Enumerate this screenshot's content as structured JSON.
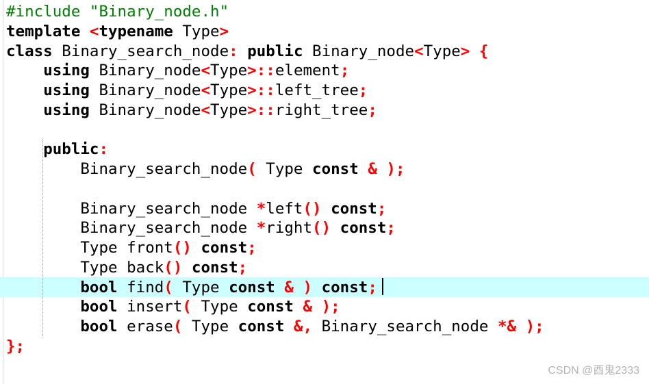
{
  "code_lines": [
    [
      {
        "cls": "pp",
        "text": "#include"
      },
      {
        "cls": "id",
        "text": " "
      },
      {
        "cls": "str",
        "text": "\"Binary_node.h\""
      }
    ],
    [
      {
        "cls": "kw",
        "text": "template"
      },
      {
        "cls": "id",
        "text": " "
      },
      {
        "cls": "op",
        "text": "<"
      },
      {
        "cls": "kw",
        "text": "typename"
      },
      {
        "cls": "id",
        "text": " Type"
      },
      {
        "cls": "op",
        "text": ">"
      }
    ],
    [
      {
        "cls": "kw",
        "text": "class"
      },
      {
        "cls": "id",
        "text": " Binary_search_node"
      },
      {
        "cls": "op",
        "text": ":"
      },
      {
        "cls": "id",
        "text": " "
      },
      {
        "cls": "kw",
        "text": "public"
      },
      {
        "cls": "id",
        "text": " Binary_node"
      },
      {
        "cls": "op",
        "text": "<"
      },
      {
        "cls": "id",
        "text": "Type"
      },
      {
        "cls": "op",
        "text": ">"
      },
      {
        "cls": "id",
        "text": " "
      },
      {
        "cls": "op",
        "text": "{"
      }
    ],
    [
      {
        "cls": "id",
        "text": "    "
      },
      {
        "cls": "kw",
        "text": "using"
      },
      {
        "cls": "id",
        "text": " Binary_node"
      },
      {
        "cls": "op",
        "text": "<"
      },
      {
        "cls": "id",
        "text": "Type"
      },
      {
        "cls": "op",
        "text": ">::"
      },
      {
        "cls": "id",
        "text": "element"
      },
      {
        "cls": "op",
        "text": ";"
      }
    ],
    [
      {
        "cls": "id",
        "text": "    "
      },
      {
        "cls": "kw",
        "text": "using"
      },
      {
        "cls": "id",
        "text": " Binary_node"
      },
      {
        "cls": "op",
        "text": "<"
      },
      {
        "cls": "id",
        "text": "Type"
      },
      {
        "cls": "op",
        "text": ">::"
      },
      {
        "cls": "id",
        "text": "left_tree"
      },
      {
        "cls": "op",
        "text": ";"
      }
    ],
    [
      {
        "cls": "id",
        "text": "    "
      },
      {
        "cls": "kw",
        "text": "using"
      },
      {
        "cls": "id",
        "text": " Binary_node"
      },
      {
        "cls": "op",
        "text": "<"
      },
      {
        "cls": "id",
        "text": "Type"
      },
      {
        "cls": "op",
        "text": ">::"
      },
      {
        "cls": "id",
        "text": "right_tree"
      },
      {
        "cls": "op",
        "text": ";"
      }
    ],
    [],
    [
      {
        "cls": "id",
        "text": "    "
      },
      {
        "cls": "kw",
        "text": "public"
      },
      {
        "cls": "op",
        "text": ":"
      }
    ],
    [
      {
        "cls": "id",
        "text": "        Binary_search_node"
      },
      {
        "cls": "op",
        "text": "("
      },
      {
        "cls": "id",
        "text": " Type "
      },
      {
        "cls": "kw",
        "text": "const"
      },
      {
        "cls": "id",
        "text": " "
      },
      {
        "cls": "op",
        "text": "&"
      },
      {
        "cls": "id",
        "text": " "
      },
      {
        "cls": "op",
        "text": ");"
      }
    ],
    [],
    [
      {
        "cls": "id",
        "text": "        Binary_search_node "
      },
      {
        "cls": "op",
        "text": "*"
      },
      {
        "cls": "id",
        "text": "left"
      },
      {
        "cls": "op",
        "text": "()"
      },
      {
        "cls": "id",
        "text": " "
      },
      {
        "cls": "kw",
        "text": "const"
      },
      {
        "cls": "op",
        "text": ";"
      }
    ],
    [
      {
        "cls": "id",
        "text": "        Binary_search_node "
      },
      {
        "cls": "op",
        "text": "*"
      },
      {
        "cls": "id",
        "text": "right"
      },
      {
        "cls": "op",
        "text": "()"
      },
      {
        "cls": "id",
        "text": " "
      },
      {
        "cls": "kw",
        "text": "const"
      },
      {
        "cls": "op",
        "text": ";"
      }
    ],
    [
      {
        "cls": "id",
        "text": "        Type front"
      },
      {
        "cls": "op",
        "text": "()"
      },
      {
        "cls": "id",
        "text": " "
      },
      {
        "cls": "kw",
        "text": "const"
      },
      {
        "cls": "op",
        "text": ";"
      }
    ],
    [
      {
        "cls": "id",
        "text": "        Type back"
      },
      {
        "cls": "op",
        "text": "()"
      },
      {
        "cls": "id",
        "text": " "
      },
      {
        "cls": "kw",
        "text": "const"
      },
      {
        "cls": "op",
        "text": ";"
      }
    ],
    [
      {
        "cls": "id",
        "text": "        "
      },
      {
        "cls": "kw",
        "text": "bool"
      },
      {
        "cls": "id",
        "text": " find"
      },
      {
        "cls": "op",
        "text": "("
      },
      {
        "cls": "id",
        "text": " Type "
      },
      {
        "cls": "kw",
        "text": "const"
      },
      {
        "cls": "id",
        "text": " "
      },
      {
        "cls": "op",
        "text": "&"
      },
      {
        "cls": "id",
        "text": " "
      },
      {
        "cls": "op",
        "text": ")"
      },
      {
        "cls": "id",
        "text": " "
      },
      {
        "cls": "kw",
        "text": "const"
      },
      {
        "cls": "op",
        "text": ";"
      }
    ],
    [
      {
        "cls": "id",
        "text": "        "
      },
      {
        "cls": "kw",
        "text": "bool"
      },
      {
        "cls": "id",
        "text": " insert"
      },
      {
        "cls": "op",
        "text": "("
      },
      {
        "cls": "id",
        "text": " Type "
      },
      {
        "cls": "kw",
        "text": "const"
      },
      {
        "cls": "id",
        "text": " "
      },
      {
        "cls": "op",
        "text": "&"
      },
      {
        "cls": "id",
        "text": " "
      },
      {
        "cls": "op",
        "text": ");"
      }
    ],
    [
      {
        "cls": "id",
        "text": "        "
      },
      {
        "cls": "kw",
        "text": "bool"
      },
      {
        "cls": "id",
        "text": " erase"
      },
      {
        "cls": "op",
        "text": "("
      },
      {
        "cls": "id",
        "text": " Type "
      },
      {
        "cls": "kw",
        "text": "const"
      },
      {
        "cls": "id",
        "text": " "
      },
      {
        "cls": "op",
        "text": "&,"
      },
      {
        "cls": "id",
        "text": " Binary_search_node "
      },
      {
        "cls": "op",
        "text": "*&"
      },
      {
        "cls": "id",
        "text": " "
      },
      {
        "cls": "op",
        "text": ");"
      }
    ],
    [
      {
        "cls": "op",
        "text": "};"
      }
    ]
  ],
  "watermark": "CSDN @酉鬼2333",
  "colors": {
    "preprocessor": "#007f00",
    "string": "#007f00",
    "keyword": "#000000",
    "operator": "#ff0000",
    "current_line_highlight": "#ccffff",
    "background": "#ffffff"
  }
}
